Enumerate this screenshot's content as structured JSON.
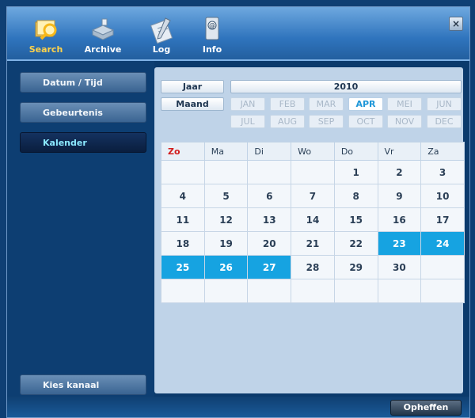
{
  "toolbar": {
    "buttons": [
      {
        "label": "Search",
        "icon": "search-icon"
      },
      {
        "label": "Archive",
        "icon": "archive-icon"
      },
      {
        "label": "Log",
        "icon": "log-icon"
      },
      {
        "label": "Info",
        "icon": "info-icon"
      }
    ],
    "close_label": "×"
  },
  "sidebar": {
    "items": [
      {
        "label": "Datum / Tijd"
      },
      {
        "label": "Gebeurtenis"
      },
      {
        "label": "Kalender",
        "active": true
      }
    ],
    "bottom_item": {
      "label": "Kies kanaal"
    }
  },
  "year_row": {
    "label": "Jaar",
    "value": "2010"
  },
  "month_row": {
    "label": "Maand",
    "months": [
      "JAN",
      "FEB",
      "MAR",
      "APR",
      "MEI",
      "JUN",
      "JUL",
      "AUG",
      "SEP",
      "OCT",
      "NOV",
      "DEC"
    ],
    "selected": "APR"
  },
  "calendar": {
    "weekdays": [
      "Zo",
      "Ma",
      "Di",
      "Wo",
      "Do",
      "Vr",
      "Za"
    ],
    "weeks": [
      [
        "",
        "",
        "",
        "",
        "1",
        "2",
        "3"
      ],
      [
        "4",
        "5",
        "6",
        "7",
        "8",
        "9",
        "10"
      ],
      [
        "11",
        "12",
        "13",
        "14",
        "15",
        "16",
        "17"
      ],
      [
        "18",
        "19",
        "20",
        "21",
        "22",
        "23",
        "24"
      ],
      [
        "25",
        "26",
        "27",
        "28",
        "29",
        "30",
        ""
      ],
      [
        "",
        "",
        "",
        "",
        "",
        "",
        ""
      ]
    ],
    "selected_days": [
      "23",
      "24",
      "25",
      "26",
      "27"
    ]
  },
  "footer": {
    "cancel_label": "Opheffen"
  },
  "colors": {
    "accent": "#16a3e1",
    "sunday": "#d21c1c",
    "active_label": "#ffd24a",
    "sidebar_active_text": "#8ce9ff"
  }
}
